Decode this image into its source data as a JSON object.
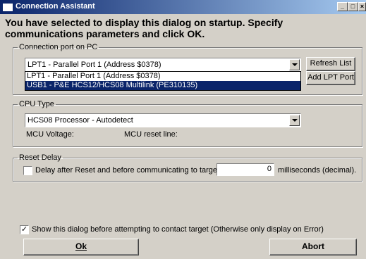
{
  "window": {
    "title": "Connection Assistant"
  },
  "intro": "You have selected to display this dialog on startup. Specify communications parameters and click OK.",
  "connection_port": {
    "legend": "Connection port on PC",
    "selected": "LPT1 - Parallel Port 1 (Address $0378)",
    "options": [
      "LPT1 - Parallel Port 1 (Address $0378)",
      "USB1 - P&E HCS12/HCS08 Multilink (PE310135)"
    ],
    "refresh_label": "Refresh List",
    "add_lpt_label": "Add LPT Port"
  },
  "cpu_type": {
    "legend": "CPU Type",
    "selected": "HCS08 Processor - Autodetect",
    "mcu_voltage_label": "MCU Voltage:",
    "mcu_reset_label": "MCU reset line:"
  },
  "reset_delay": {
    "legend": "Reset Delay",
    "checkbox_label": "Delay after Reset and before communicating to target for",
    "checked": false,
    "value": "0",
    "unit_label": "milliseconds (decimal)."
  },
  "show_dialog": {
    "label": "Show this dialog before attempting to contact target (Otherwise only display on Error)",
    "checked": true
  },
  "buttons": {
    "ok": "Ok",
    "abort": "Abort"
  }
}
